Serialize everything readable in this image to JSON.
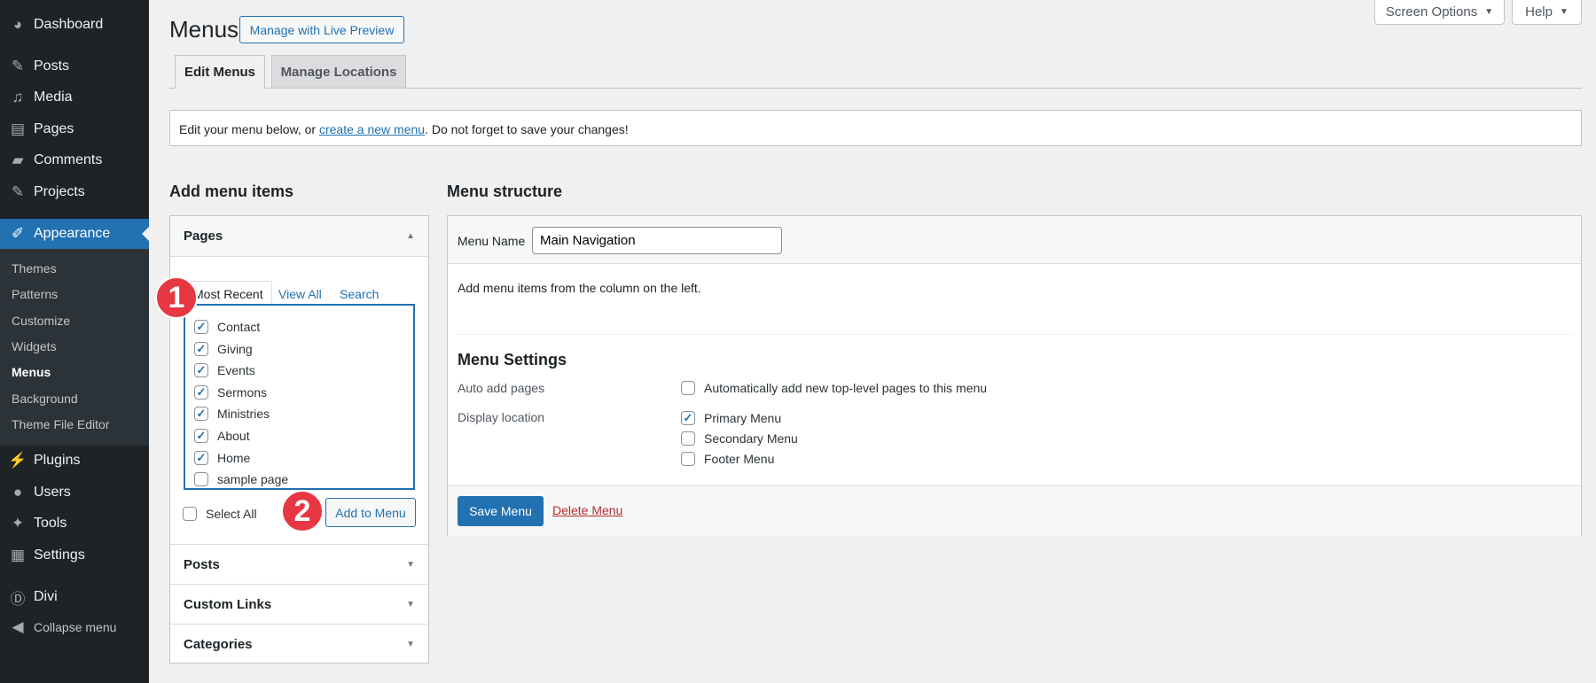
{
  "sidebar": {
    "items": [
      {
        "label": "Dashboard",
        "icon": "dashboard-icon"
      },
      {
        "label": "Posts",
        "icon": "pin-icon"
      },
      {
        "label": "Media",
        "icon": "media-icon"
      },
      {
        "label": "Pages",
        "icon": "pages-icon"
      },
      {
        "label": "Comments",
        "icon": "comment-icon"
      },
      {
        "label": "Projects",
        "icon": "pin-icon"
      },
      {
        "label": "Appearance",
        "icon": "brush-icon",
        "active": true
      },
      {
        "label": "Plugins",
        "icon": "plugin-icon"
      },
      {
        "label": "Users",
        "icon": "user-icon"
      },
      {
        "label": "Tools",
        "icon": "wrench-icon"
      },
      {
        "label": "Settings",
        "icon": "settings-icon"
      },
      {
        "label": "Divi",
        "icon": "divi-icon"
      },
      {
        "label": "Collapse menu",
        "icon": "collapse-icon"
      }
    ],
    "submenu": [
      "Themes",
      "Patterns",
      "Customize",
      "Widgets",
      "Menus",
      "Background",
      "Theme File Editor"
    ],
    "current_submenu": "Menus"
  },
  "header": {
    "screen_options": "Screen Options",
    "help": "Help",
    "title": "Menus",
    "live_preview": "Manage with Live Preview"
  },
  "tabs": [
    "Edit Menus",
    "Manage Locations"
  ],
  "notice": {
    "before": "Edit your menu below, or ",
    "link": "create a new menu",
    "after": ". Do not forget to save your changes!"
  },
  "left": {
    "title": "Add menu items",
    "pages": {
      "title": "Pages",
      "tabs": [
        "Most Recent",
        "View All",
        "Search"
      ],
      "items": [
        {
          "label": "Contact",
          "checked": true
        },
        {
          "label": "Giving",
          "checked": true
        },
        {
          "label": "Events",
          "checked": true
        },
        {
          "label": "Sermons",
          "checked": true
        },
        {
          "label": "Ministries",
          "checked": true
        },
        {
          "label": "About",
          "checked": true
        },
        {
          "label": "Home",
          "checked": true
        },
        {
          "label": "sample page",
          "checked": false
        }
      ],
      "select_all": "Select All",
      "add_button": "Add to Menu"
    },
    "sections": [
      "Posts",
      "Custom Links",
      "Categories"
    ]
  },
  "right": {
    "title": "Menu structure",
    "menu_name_label": "Menu Name",
    "menu_name_value": "Main Navigation",
    "hint": "Add menu items from the column on the left.",
    "settings_title": "Menu Settings",
    "auto_add_label": "Auto add pages",
    "auto_add_option": "Automatically add new top-level pages to this menu",
    "auto_add_checked": false,
    "display_location_label": "Display location",
    "locations": [
      {
        "label": "Primary Menu",
        "checked": true
      },
      {
        "label": "Secondary Menu",
        "checked": false
      },
      {
        "label": "Footer Menu",
        "checked": false
      }
    ],
    "save": "Save Menu",
    "delete": "Delete Menu"
  },
  "badges": [
    "1",
    "2"
  ],
  "colors": {
    "sidebar": "#1d2327",
    "accent": "#2271b1",
    "badge": "#e63743",
    "delete": "#b32d2e"
  }
}
